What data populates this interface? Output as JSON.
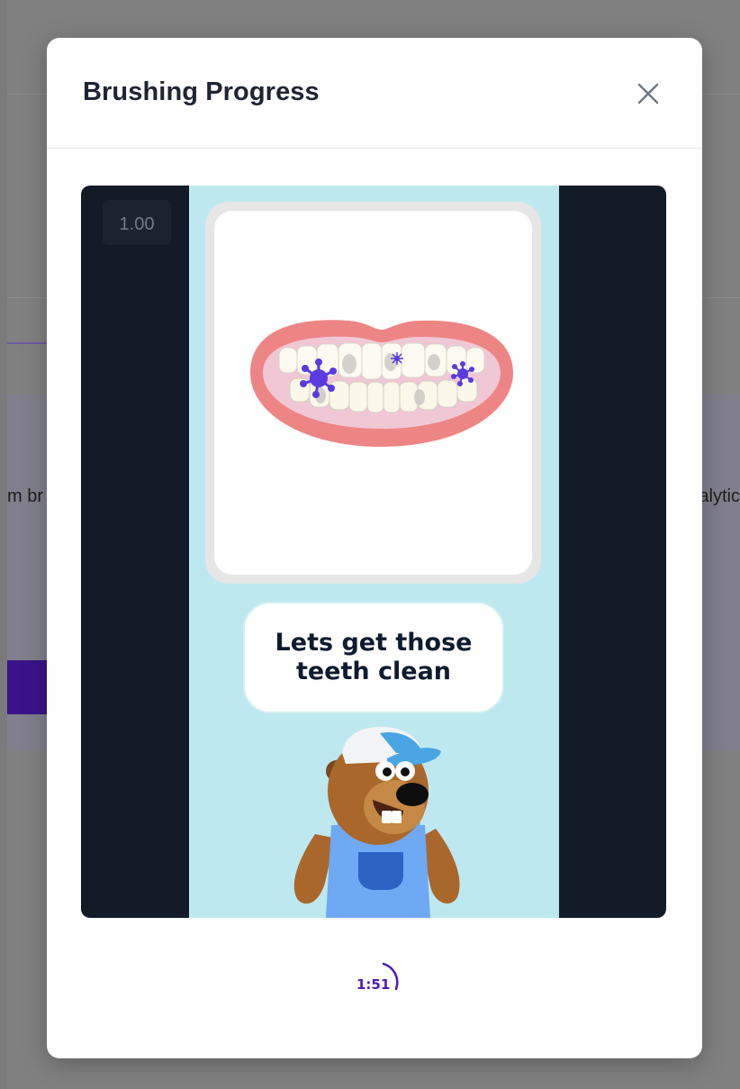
{
  "background": {
    "left_text": "m br",
    "right_text": "alytic"
  },
  "modal": {
    "title": "Brushing Progress",
    "close_icon": "close-icon"
  },
  "player": {
    "speed": "1.00",
    "speech": "Lets get those teeth clean",
    "mascot": "beaver-mascot-illustration",
    "mouth": "teeth-with-germs-illustration"
  },
  "timer": {
    "label": "1:51",
    "color": "#4a1bb8"
  },
  "colors": {
    "game_background": "#bde8ef",
    "frame_background": "#131a28",
    "germ": "#5a3be0"
  }
}
